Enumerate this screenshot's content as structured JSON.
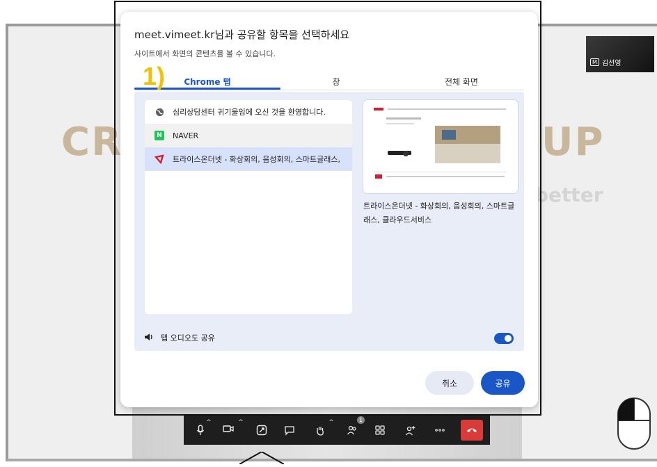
{
  "background": {
    "text_left": "CR",
    "text_right": "UP",
    "text_sub": "better",
    "participant_badge": "M",
    "participant_name": "김선영"
  },
  "annotation": {
    "label": "1)"
  },
  "dialog": {
    "title": "meet.vimeet.kr님과 공유할 항목을 선택하세요",
    "subtitle": "사이트에서 화면의 콘텐츠를 볼 수 있습니다.",
    "tabs": [
      {
        "label": "Chrome 탭",
        "active": true
      },
      {
        "label": "창",
        "active": false
      },
      {
        "label": "전체 화면",
        "active": false
      }
    ],
    "tab_list": [
      {
        "icon": "globe-icon",
        "label": "심리상담센터 귀기울임에 오신 것을 환영합니다."
      },
      {
        "icon": "naver-icon",
        "label": "NAVER"
      },
      {
        "icon": "trius-icon",
        "label": "트라이스온더넷 - 화상회의, 음성회의, 스마트글래스,"
      }
    ],
    "preview_caption": "트라이스온더넷 - 화상회의, 음성회의, 스마트글래스, 클라우드서비스",
    "audio_label": "탭 오디오도 공유",
    "audio_enabled": true,
    "cancel_label": "취소",
    "share_label": "공유"
  },
  "toolbar": {
    "participant_count": "1",
    "accent_hangup": "#d93a3a"
  },
  "colors": {
    "accent": "#1a56c6",
    "selected_row": "#d7e2fa",
    "panel": "#e8edf7"
  }
}
